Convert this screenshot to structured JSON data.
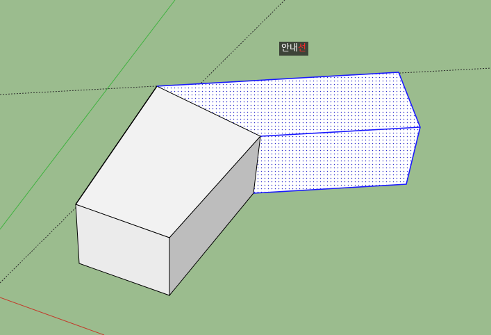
{
  "viewport": {
    "background": "#9bbc8e",
    "axes": {
      "green": "#3fb23f",
      "red": "#c23a2a"
    },
    "selection_color": "#1a1aff",
    "tool_tip": {
      "text": "안내선",
      "caret": "선"
    }
  }
}
